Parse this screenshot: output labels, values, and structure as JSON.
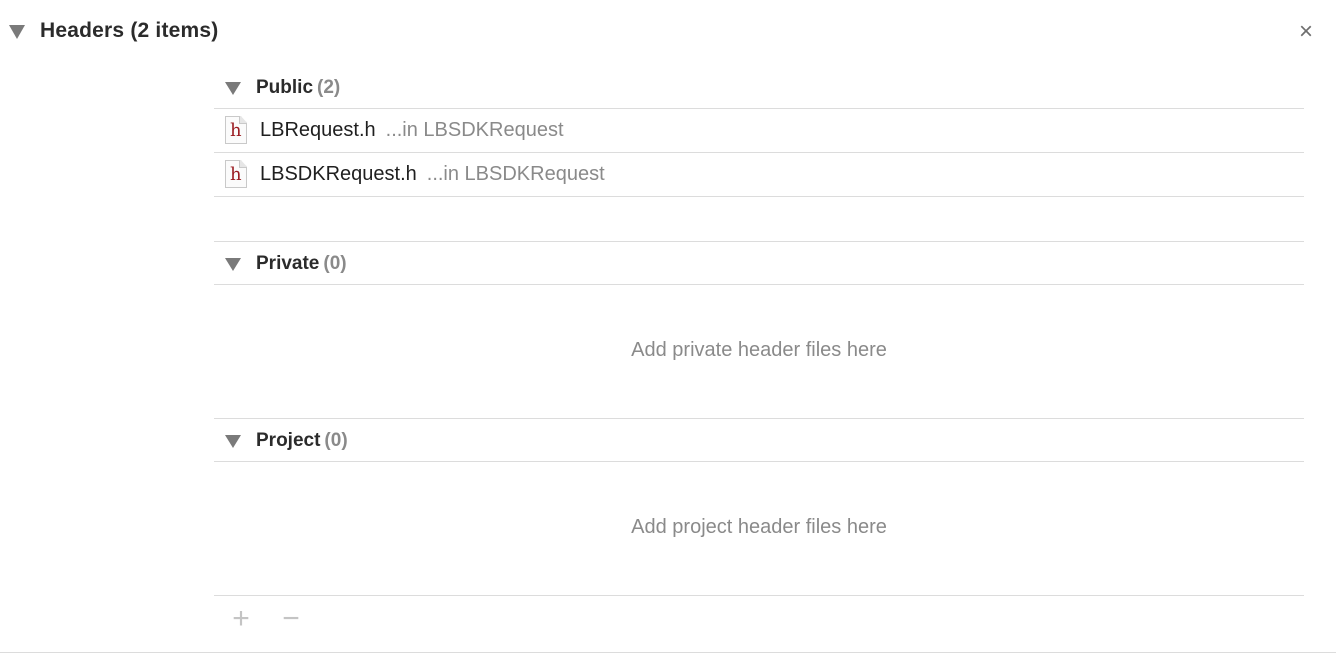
{
  "phase": {
    "title": "Headers (2 items)",
    "close_glyph": "×"
  },
  "sections": {
    "public": {
      "name": "Public",
      "count": "(2)",
      "files": [
        {
          "icon_letter": "h",
          "name": "LBRequest.h",
          "location": "...in LBSDKRequest"
        },
        {
          "icon_letter": "h",
          "name": "LBSDKRequest.h",
          "location": "...in LBSDKRequest"
        }
      ]
    },
    "private": {
      "name": "Private",
      "count": "(0)",
      "placeholder": "Add private header files here"
    },
    "project": {
      "name": "Project",
      "count": "(0)",
      "placeholder": "Add project header files here"
    }
  },
  "toolbar": {
    "add_glyph": "+",
    "remove_glyph": "−"
  },
  "icons": {
    "disclosure": "disclosure-triangle-icon",
    "close": "close-icon",
    "file": "header-file-icon",
    "add": "plus-icon",
    "remove": "minus-icon"
  },
  "colors": {
    "header_file_letter": "#9b1c22",
    "secondary_text": "#8a8a8a",
    "separator": "#dcdcdc"
  }
}
